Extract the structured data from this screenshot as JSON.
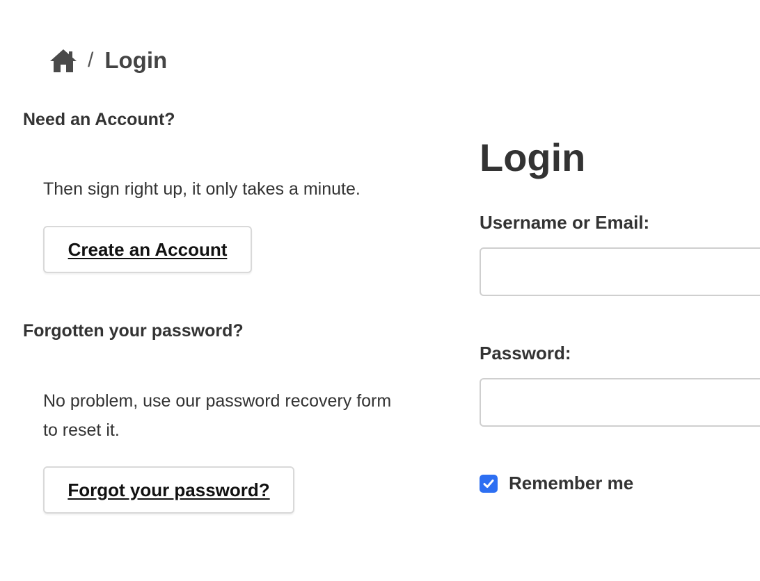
{
  "breadcrumb": {
    "home_icon": "home-icon",
    "separator": "/",
    "current": "Login"
  },
  "signup": {
    "heading": "Need an Account?",
    "text": "Then sign right up, it only takes a minute.",
    "button_label": "Create an Account"
  },
  "recovery": {
    "heading": "Forgotten your password?",
    "text": "No problem, use our password recovery form to reset it.",
    "button_label": "Forgot your password?"
  },
  "login": {
    "title": "Login",
    "username_label": "Username or Email:",
    "username_value": "",
    "password_label": "Password:",
    "password_value": "",
    "remember_label": "Remember me",
    "remember_checked": true
  },
  "colors": {
    "text": "#333333",
    "checkbox_accent": "#2d6ff2",
    "input_border": "#cfcfcf"
  }
}
